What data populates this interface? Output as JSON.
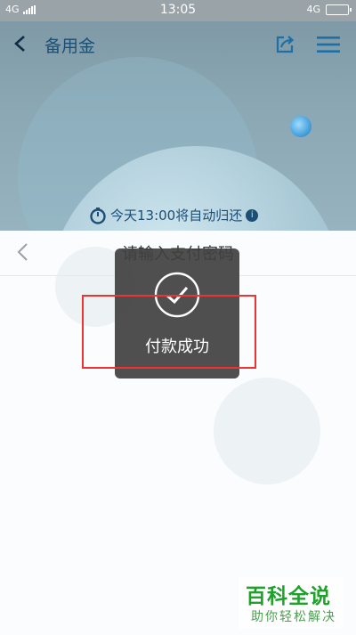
{
  "status_bar": {
    "network_left": "4G",
    "time": "13:05",
    "network_right": "4G"
  },
  "header": {
    "title": "备用金"
  },
  "notice": {
    "text": "今天13:00将自动归还",
    "info_glyph": "i"
  },
  "sheet": {
    "title": "请输入支付密码"
  },
  "toast": {
    "message": "付款成功"
  },
  "watermark": {
    "line1": "百科全说",
    "line2": "助你轻松解决"
  },
  "colors": {
    "accent": "#1d6fa5",
    "highlight": "#e33333",
    "toast_bg": "#404040"
  }
}
